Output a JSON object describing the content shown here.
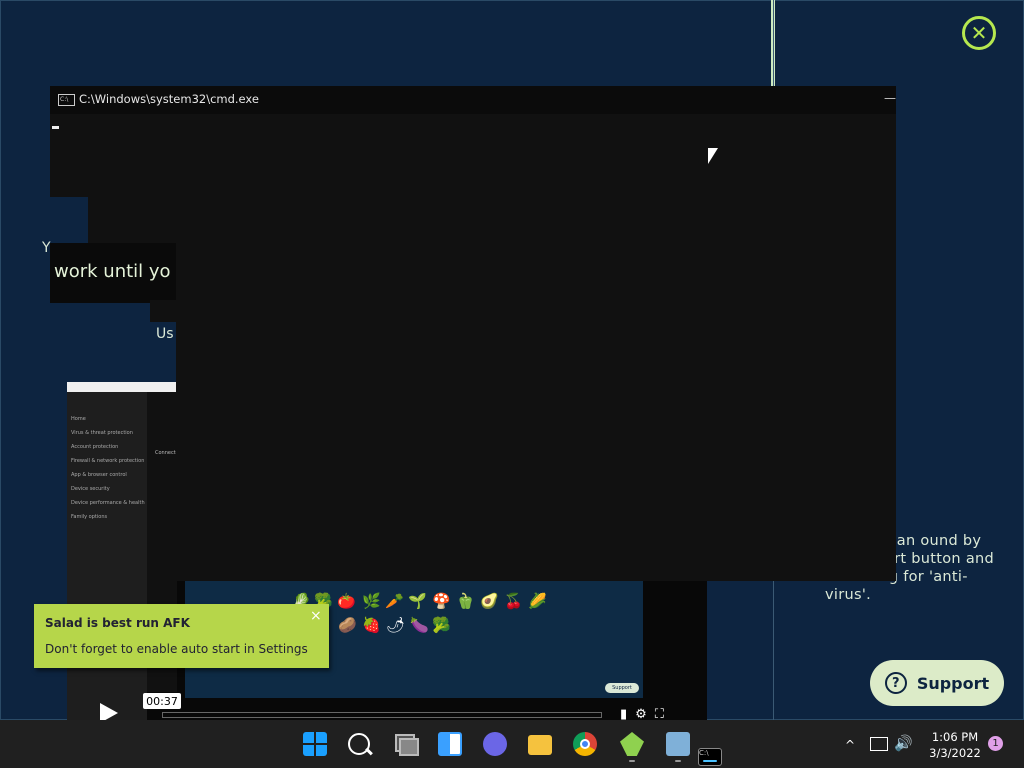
{
  "cmd": {
    "title": "C:\\Windows\\system32\\cmd.exe",
    "minimize": "—",
    "icon_text": "C:\\"
  },
  "background": {
    "fragment_y": "Y",
    "fragment_work": "work until yo",
    "fragment_us": "Us",
    "info_text": "rmation can ound by he support button and searching for 'anti-virus'.",
    "support_label": "Support",
    "video": {
      "time": "00:37",
      "mid_text": "Connected to the internet",
      "support_small": "Support",
      "menu": [
        "Home",
        "Virus & threat protection",
        "Account protection",
        "Firewall & network protection",
        "App & browser control",
        "Device security",
        "Device performance & health",
        "Family options"
      ]
    }
  },
  "toast": {
    "title": "Salad is best run AFK",
    "message": "Don't forget to enable auto start in Settings",
    "close": "×"
  },
  "taskbar": {
    "apps": [
      "start-icon",
      "search-icon",
      "task-view-icon",
      "widgets-icon",
      "chat-icon",
      "file-explorer-icon",
      "chrome-icon",
      "salad-icon",
      "resource-monitor-icon",
      "cmd-icon"
    ],
    "chevron": "^",
    "volume": "🔊",
    "time": "1:06 PM",
    "date": "3/3/2022",
    "notification_count": "1"
  },
  "colors": {
    "accent": "#b6e84f",
    "toast": "#b6d64a",
    "background": "#0d2440"
  }
}
